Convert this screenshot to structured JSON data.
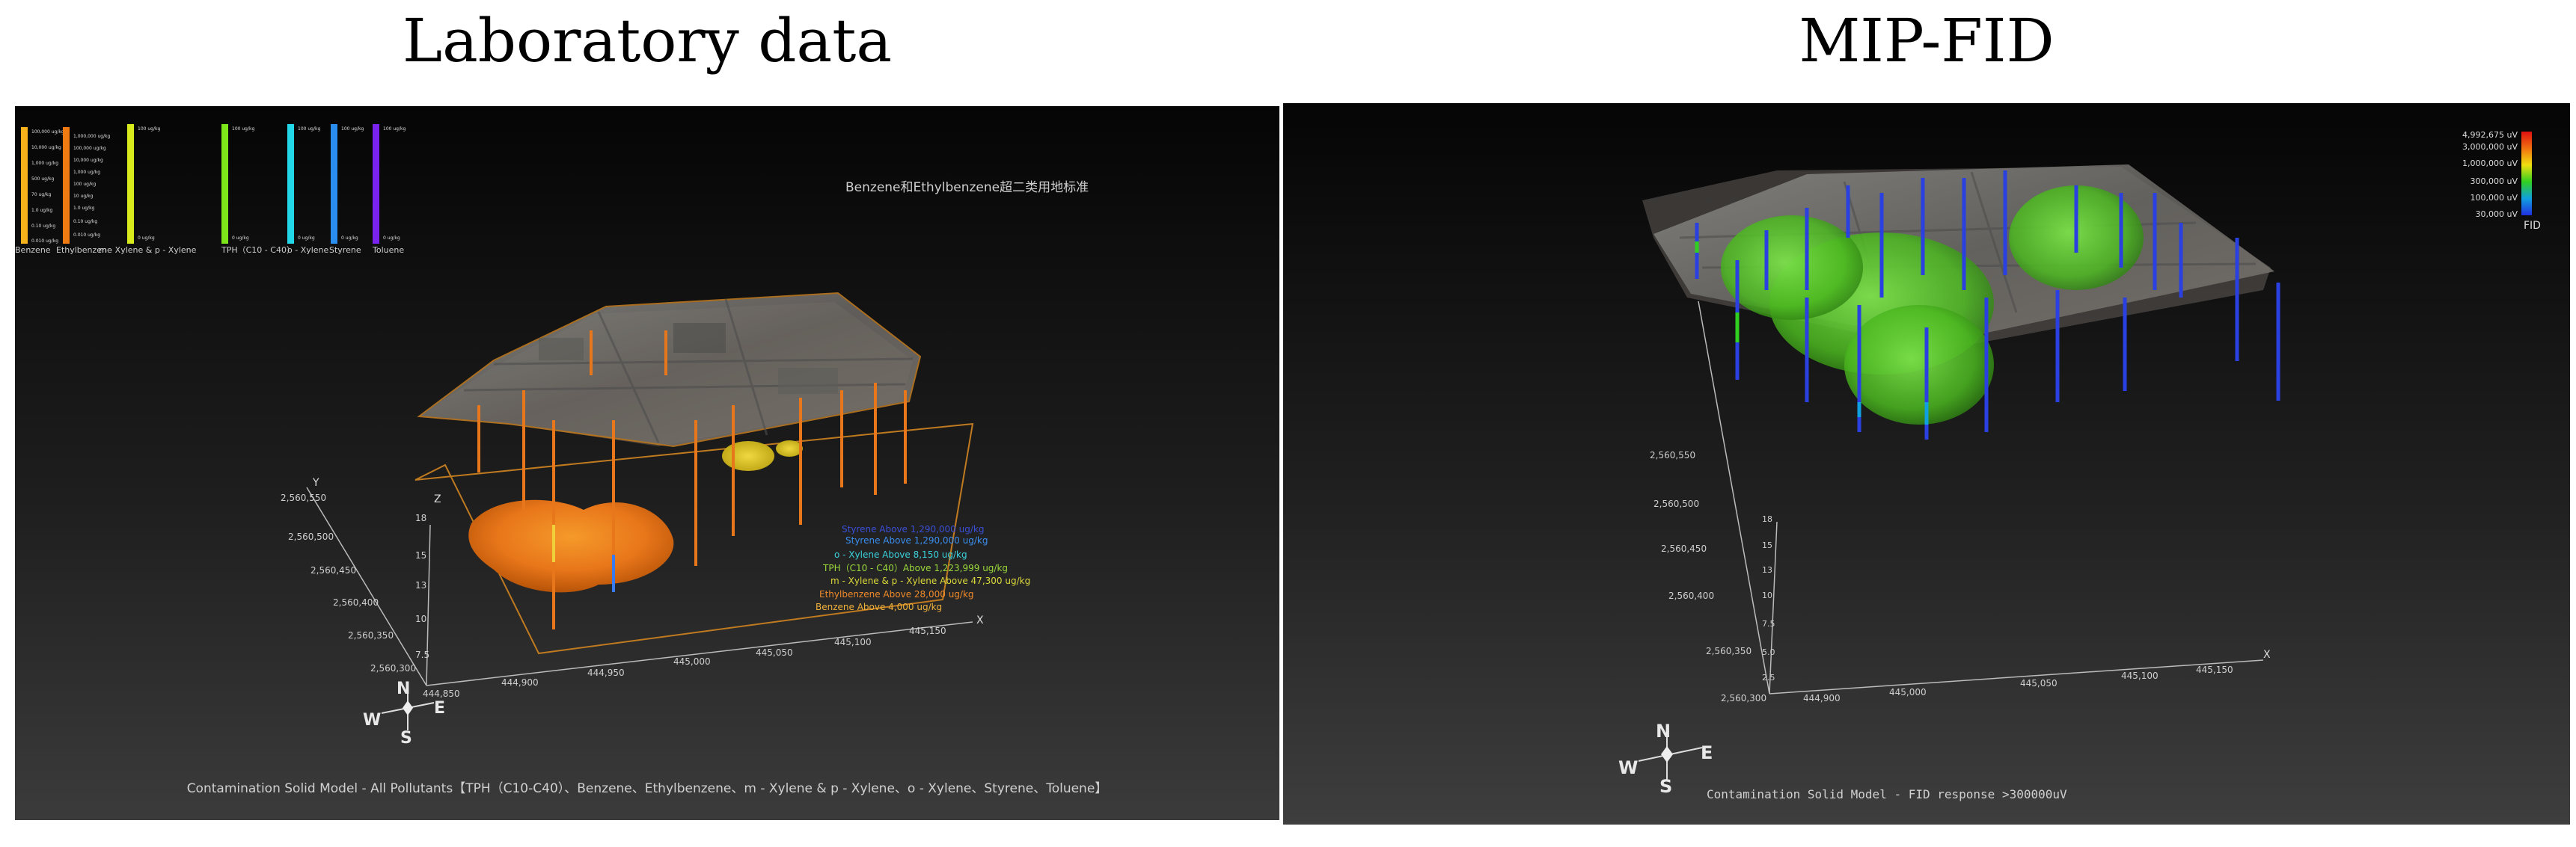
{
  "left": {
    "heading": "Laboratory data",
    "scalebars": [
      {
        "name": "Benzene",
        "color": "#f5b21a",
        "ticks": [
          "100,000 ug/kg",
          "10,000 ug/kg",
          "1,000 ug/kg",
          "500 ug/kg",
          "70 ug/kg",
          "1.0 ug/kg",
          "0.10 ug/kg",
          "0.010 ug/kg"
        ]
      },
      {
        "name": "Ethylbenzene",
        "color": "#f07a12",
        "ticks": [
          "1,000,000 ug/kg",
          "100,000 ug/kg",
          "10,000 ug/kg",
          "1,000 ug/kg",
          "100 ug/kg",
          "10 ug/kg",
          "1.0 ug/kg",
          "0.10 ug/kg",
          "0.010 ug/kg"
        ]
      },
      {
        "name": "m - Xylene & p - Xylene",
        "color": "#d8ea1c",
        "ticks": [
          "100 ug/kg",
          "0 ug/kg"
        ]
      },
      {
        "name": "TPH（C10 - C40）",
        "color": "#7ce61a",
        "ticks": [
          "100 ug/kg",
          "0 ug/kg"
        ]
      },
      {
        "name": "o - Xylene",
        "color": "#22d8e8",
        "ticks": [
          "100 ug/kg",
          "0 ug/kg"
        ]
      },
      {
        "name": "Styrene",
        "color": "#2a8ef0",
        "ticks": [
          "100 ug/kg",
          "0 ug/kg"
        ]
      },
      {
        "name": "Toluene",
        "color": "#7a22f0",
        "ticks": [
          "100 ug/kg",
          "0 ug/kg"
        ]
      }
    ],
    "standard_label": "Benzene和Ethylbenzene超二类用地标准",
    "legend": [
      {
        "text": "Styrene Above 1,290,000 ug/kg",
        "color": "#3a4fd8"
      },
      {
        "text": "Styrene Above 1,290,000 ug/kg",
        "color": "#3a8ef0"
      },
      {
        "text": "o - Xylene Above 8,150 ug/kg",
        "color": "#3ad2dc"
      },
      {
        "text": "TPH（C10 - C40）Above 1,223,999 ug/kg",
        "color": "#9ad83a"
      },
      {
        "text": "m - Xylene & p - Xylene Above 47,300 ug/kg",
        "color": "#dcd83a"
      },
      {
        "text": "Ethylbenzene Above 28,000 ug/kg",
        "color": "#f08a2a"
      },
      {
        "text": "Benzene Above 4,000 ug/kg",
        "color": "#f0b23a"
      }
    ],
    "axis_y_label": "Y",
    "axis_x_label": "X",
    "axis_z_label": "Z",
    "y_ticks": [
      "2,560,550",
      "2,560,500",
      "2,560,450",
      "2,560,400",
      "2,560,350",
      "2,560,300"
    ],
    "x_ticks": [
      "444,850",
      "444,900",
      "444,950",
      "445,000",
      "445,050",
      "445,100",
      "445,150"
    ],
    "z_ticks": [
      "18",
      "15",
      "13",
      "10",
      "7.5"
    ],
    "compass": {
      "N": "N",
      "S": "S",
      "E": "E",
      "W": "W"
    },
    "caption": "Contamination Solid Model - All Pollutants【TPH（C10-C40）、Benzene、Ethylbenzene、m - Xylene & p - Xylene、o - Xylene、Styrene、Toluene】"
  },
  "right": {
    "heading": "MIP-FID",
    "colorbar_ticks": [
      "4,992,675 uV",
      "3,000,000 uV",
      "1,000,000 uV",
      "300,000 uV",
      "100,000 uV",
      "30,000 uV"
    ],
    "colorbar_title": "FID",
    "y_ticks": [
      "2,560,550",
      "2,560,500",
      "2,560,450",
      "2,560,400",
      "2,560,350",
      "2,560,300"
    ],
    "x_ticks": [
      "444,900",
      "445,000",
      "445,050",
      "445,100",
      "445,150"
    ],
    "z_ticks": [
      "18",
      "15",
      "13",
      "10",
      "7.5",
      "5.0",
      "2.5"
    ],
    "axis_x_label": "X",
    "compass": {
      "N": "N",
      "S": "S",
      "E": "E",
      "W": "W"
    },
    "caption": "Contamination Solid Model - FID response >300000uV"
  }
}
